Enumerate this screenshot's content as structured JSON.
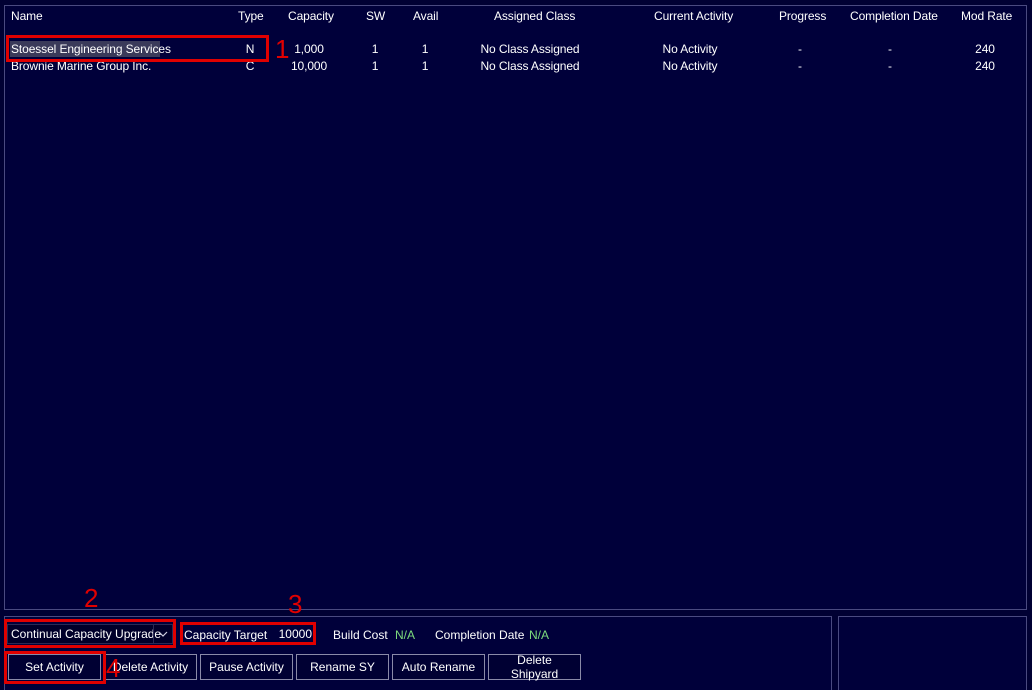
{
  "table": {
    "headers": [
      "Name",
      "Type",
      "Capacity",
      "SW",
      "Avail",
      "Assigned Class",
      "Current Activity",
      "Progress",
      "Completion Date",
      "Mod Rate"
    ],
    "rows": [
      {
        "name": "Stoessel Engineering Services",
        "type": "N",
        "capacity": "1,000",
        "sw": "1",
        "avail": "1",
        "assigned_class": "No Class Assigned",
        "current_activity": "No Activity",
        "progress": "-",
        "completion_date": "-",
        "mod_rate": "240"
      },
      {
        "name": "Brownie Marine Group Inc.",
        "type": "C",
        "capacity": "10,000",
        "sw": "1",
        "avail": "1",
        "assigned_class": "No Class Assigned",
        "current_activity": "No Activity",
        "progress": "-",
        "completion_date": "-",
        "mod_rate": "240"
      }
    ]
  },
  "controls": {
    "activity_select": "Continual Capacity Upgrade",
    "capacity_target_label": "Capacity Target",
    "capacity_target_value": "10000",
    "build_cost_label": "Build Cost",
    "build_cost_value": "N/A",
    "completion_date_label": "Completion Date",
    "completion_date_value": "N/A"
  },
  "buttons": {
    "set_activity": "Set Activity",
    "delete_activity": "Delete Activity",
    "pause_activity": "Pause Activity",
    "rename_sy": "Rename SY",
    "auto_rename": "Auto Rename",
    "delete_shipyard": "Delete Shipyard"
  },
  "annotations": [
    "1",
    "2",
    "3",
    "4"
  ],
  "colors": {
    "background": "#000033",
    "annotation": "#e00000",
    "value_green": "#7ddc7d"
  }
}
